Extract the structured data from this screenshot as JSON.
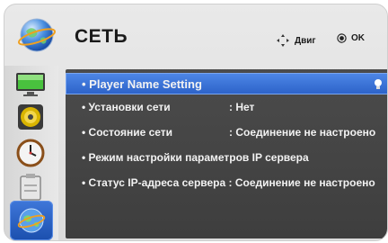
{
  "header": {
    "title": "СЕТЬ",
    "title_icon": "network-globe-icon",
    "hint_move": "Двиг",
    "hint_ok": "OK"
  },
  "sidebar": {
    "items": [
      {
        "icon": "picture-tv-icon"
      },
      {
        "icon": "audio-speaker-icon"
      },
      {
        "icon": "clock-icon"
      },
      {
        "icon": "options-toolbox-icon"
      },
      {
        "icon": "network-globe-icon",
        "selected": true
      }
    ]
  },
  "menu": {
    "items": [
      {
        "label": "• Player Name Setting",
        "value": "",
        "selected": true
      },
      {
        "label": "• Установки сети",
        "value": ": Нет"
      },
      {
        "label": "• Состояние сети",
        "value": ": Соединение не настроено"
      },
      {
        "label": "• Режим настройки параметров IP сервера",
        "value": ""
      },
      {
        "label": "• Статус IP-адреса сервера : Соединение не настроено",
        "value": ""
      }
    ]
  },
  "colors": {
    "accent": "#2d63c9",
    "panel": "#454545",
    "frame": "#e2e2e2"
  }
}
